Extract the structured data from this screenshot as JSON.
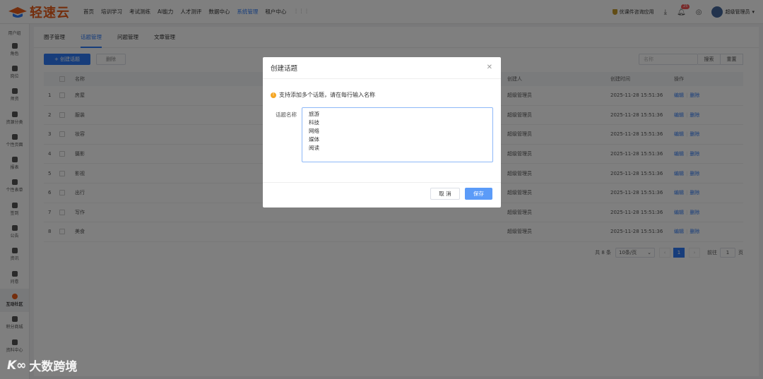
{
  "brand": {
    "name": "轻速云",
    "accent": "#e85d1a"
  },
  "topnav": [
    "首页",
    "培训学习",
    "考试测练",
    "AI能力",
    "人才测评",
    "数据中心",
    "系统管理",
    "租户中心"
  ],
  "topnav_active": "系统管理",
  "topright": {
    "service": "优课件咨询应用",
    "badge": "25",
    "user": "超级管理员"
  },
  "sidebar": [
    "用户组",
    "角色",
    "岗位",
    "师资",
    "资源分类",
    "个性页面",
    "报表",
    "个性表单",
    "签到",
    "公告",
    "资讯",
    "问卷",
    "互动社区",
    "积分商城",
    "资料中心"
  ],
  "sidebar_active": "互动社区",
  "tabs": [
    "圈子管理",
    "话题管理",
    "问题管理",
    "文章管理"
  ],
  "tabs_active": "话题管理",
  "toolbar": {
    "create": "+ 创建话题",
    "delete": "删除"
  },
  "search": {
    "placeholder": "名称",
    "search_btn": "搜索",
    "reset_btn": "重置"
  },
  "table": {
    "headers": {
      "name": "名称",
      "creator": "创建人",
      "time": "创建时间",
      "op": "操作"
    },
    "rows": [
      {
        "idx": "1",
        "name": "房屋",
        "creator": "超级管理员",
        "time": "2025-11-28 15:51:36"
      },
      {
        "idx": "2",
        "name": "服装",
        "creator": "超级管理员",
        "time": "2025-11-28 15:51:36"
      },
      {
        "idx": "3",
        "name": "妆容",
        "creator": "超级管理员",
        "time": "2025-11-28 15:51:36"
      },
      {
        "idx": "4",
        "name": "摄影",
        "creator": "超级管理员",
        "time": "2025-11-28 15:51:36"
      },
      {
        "idx": "5",
        "name": "影视",
        "creator": "超级管理员",
        "time": "2025-11-28 15:51:36"
      },
      {
        "idx": "6",
        "name": "出行",
        "creator": "超级管理员",
        "time": "2025-11-28 15:51:36"
      },
      {
        "idx": "7",
        "name": "写作",
        "creator": "超级管理员",
        "time": "2025-11-28 15:51:36"
      },
      {
        "idx": "8",
        "name": "美食",
        "creator": "超级管理员",
        "time": "2025-11-28 15:51:36"
      }
    ],
    "op_edit": "编辑",
    "op_delete": "删除"
  },
  "pager": {
    "total": "共 8 条",
    "size": "10条/页",
    "current": "1",
    "goto": "前往",
    "goto_value": "1",
    "page": "页"
  },
  "modal": {
    "title": "创建话题",
    "tip": "支持添加多个话题，请在每行输入名称",
    "label": "话题名称",
    "textarea_value": "旅游\n科技\n网络\n媒体\n阅读",
    "cancel": "取 消",
    "save": "保存"
  },
  "watermark": "大数跨境"
}
